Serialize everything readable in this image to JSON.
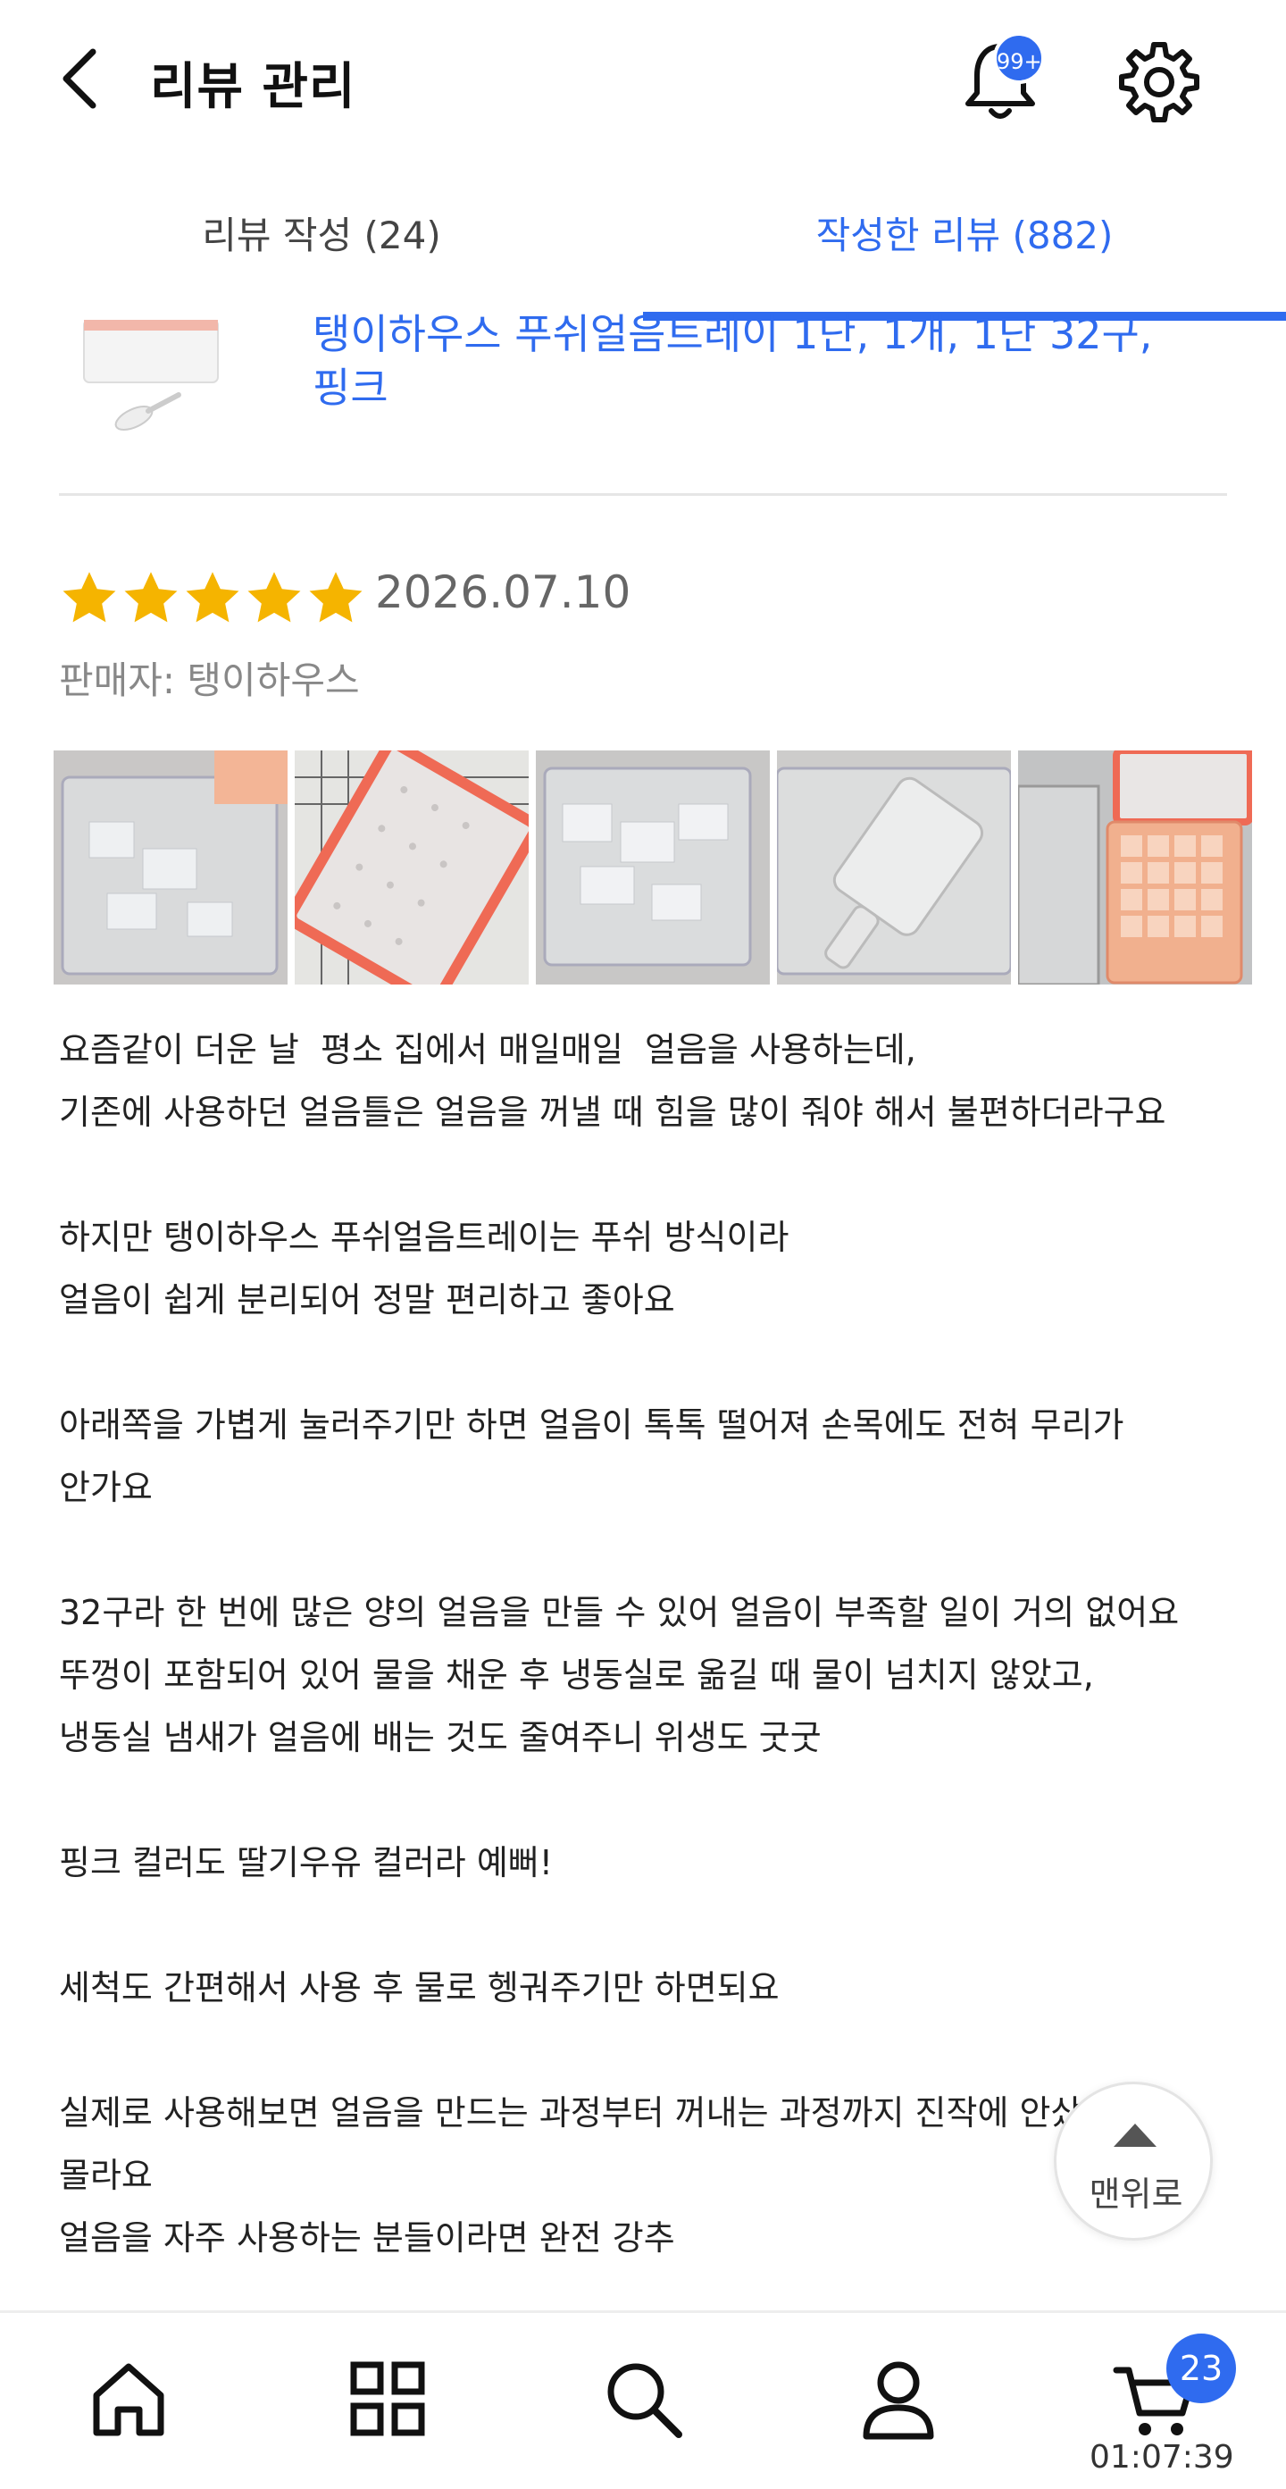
{
  "header": {
    "title": "리뷰 관리",
    "notification_badge": "99+"
  },
  "tabs": [
    {
      "label": "리뷰 작성 (24)",
      "active": false
    },
    {
      "label": "작성한 리뷰 (882)",
      "active": true
    }
  ],
  "product": {
    "title_line1": "탱이하우스 푸쉬얼음트레이 1단, 1개, 1단 32구,",
    "title_line2": "핑크"
  },
  "review": {
    "rating": 5,
    "date": "2026.07.10",
    "seller": "판매자: 탱이하우스",
    "photos": [
      "photo-1",
      "photo-2",
      "photo-3",
      "photo-4",
      "photo-5"
    ],
    "lines": [
      "요즘같이 더운 날  평소 집에서 매일매일  얼음을 사용하는데,",
      "기존에 사용하던 얼음틀은 얼음을 꺼낼 때 힘을 많이 줘야 해서 불편하더라구요",
      "",
      "하지만 탱이하우스 푸쉬얼음트레이는 푸쉬 방식이라",
      "얼음이 쉽게 분리되어 정말 편리하고 좋아요",
      "",
      "아래쪽을 가볍게 눌러주기만 하면 얼음이 톡톡 떨어져 손목에도 전혀 무리가",
      "안가요",
      "",
      "32구라 한 번에 많은 양의 얼음을 만들 수 있어 얼음이 부족할 일이 거의 없어요",
      "뚜껑이 포함되어 있어 물을 채운 후 냉동실로 옮길 때 물이 넘치지 않았고,",
      "냉동실 냄새가 얼음에 배는 것도 줄여주니 위생도 굿굿",
      "",
      "핑크 컬러도 딸기우유 컬러라 예뻐!",
      "",
      "세척도 간편해서 사용 후 물로 헹궈주기만 하면되요",
      "",
      "실제로 사용해보면 얼음을 만드는 과정부터 꺼내는 과정까지 진작에 안샀는",
      "몰라요",
      "얼음을 자주 사용하는 분들이라면 완전 강추"
    ]
  },
  "scroll_top": {
    "label": "맨위로"
  },
  "bottom_nav": {
    "items": [
      "home-icon",
      "category-icon",
      "search-icon",
      "my-page-icon",
      "cart-icon"
    ],
    "cart_count": "23",
    "clock": "01:07:39"
  },
  "colors": {
    "accent": "#2f6bef",
    "star": "#f5b400"
  }
}
